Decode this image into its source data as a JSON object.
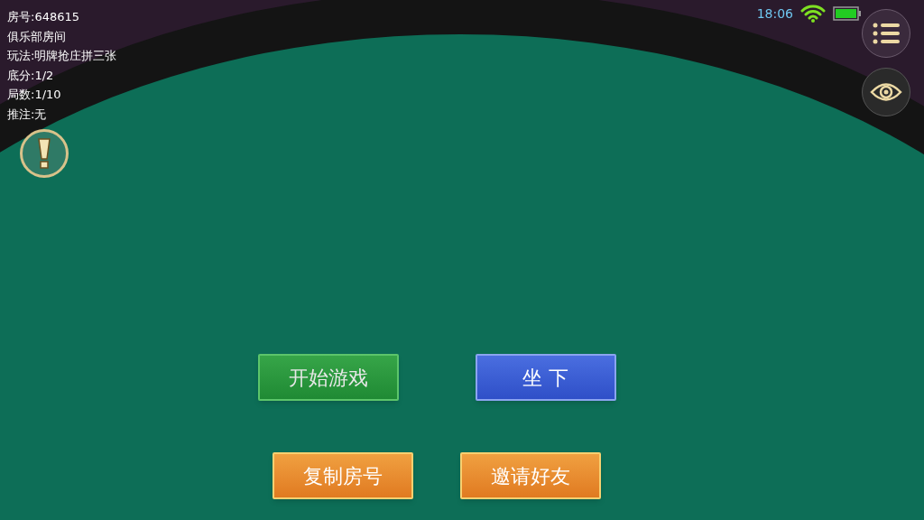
{
  "room_info": [
    "房号:648615",
    "俱乐部房间",
    "玩法:明牌抢庄拼三张",
    "底分:1/2",
    "局数:1/10",
    "推注:无"
  ],
  "status_bar": {
    "time": "18:06"
  },
  "actions": [
    {
      "label": "开始游戏",
      "kind": "green"
    },
    {
      "label": "坐 下",
      "kind": "blue"
    },
    {
      "label": "复制房号",
      "kind": "orange"
    },
    {
      "label": "邀请好友",
      "kind": "orange"
    }
  ]
}
